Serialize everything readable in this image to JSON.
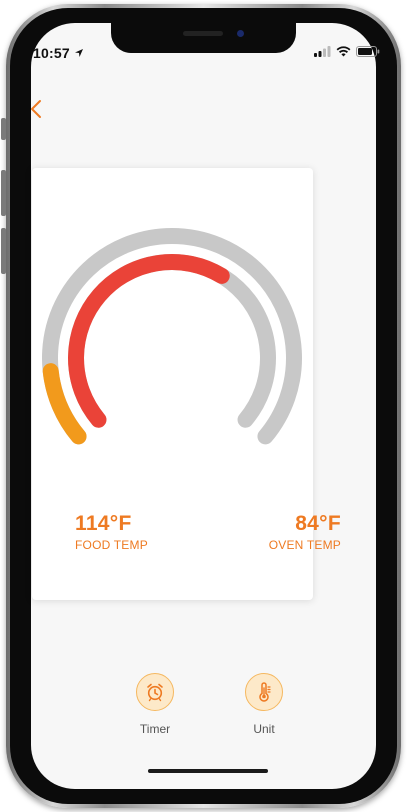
{
  "status_bar": {
    "time": "10:57"
  },
  "gauge": {
    "food_temp_fraction": 0.62,
    "oven_temp_fraction": 0.13
  },
  "food": {
    "value": "114°F",
    "label": "FOOD TEMP"
  },
  "oven": {
    "value": "84°F",
    "label": "OVEN TEMP"
  },
  "bottom_bar": {
    "timer_label": "Timer",
    "unit_label": "Unit"
  },
  "colors": {
    "accent": "#ee7a22",
    "food_arc": "#ea4338",
    "oven_arc": "#f29a1c",
    "track": "#c8c8c8"
  }
}
